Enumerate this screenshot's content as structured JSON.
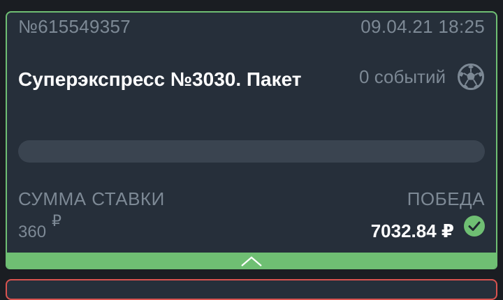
{
  "bet": {
    "id": "№615549357",
    "date": "09.04.21 18:25",
    "title": "Суперэкспресс №3030. Пакет",
    "events_count": "0 событий",
    "sport_icon": "soccer-ball-icon",
    "stake_label": "СУММА СТАВКИ",
    "stake_value": "360",
    "stake_currency": "₽",
    "win_label": "ПОБЕДА",
    "win_value": "7032.84 ₽",
    "status_icon": "check-circle-icon"
  },
  "colors": {
    "card_bg": "#262f3a",
    "accent_green": "#6fbf73",
    "muted_text": "#7d8995",
    "progress_track": "#3a4450",
    "next_card_border": "#d9534f"
  }
}
